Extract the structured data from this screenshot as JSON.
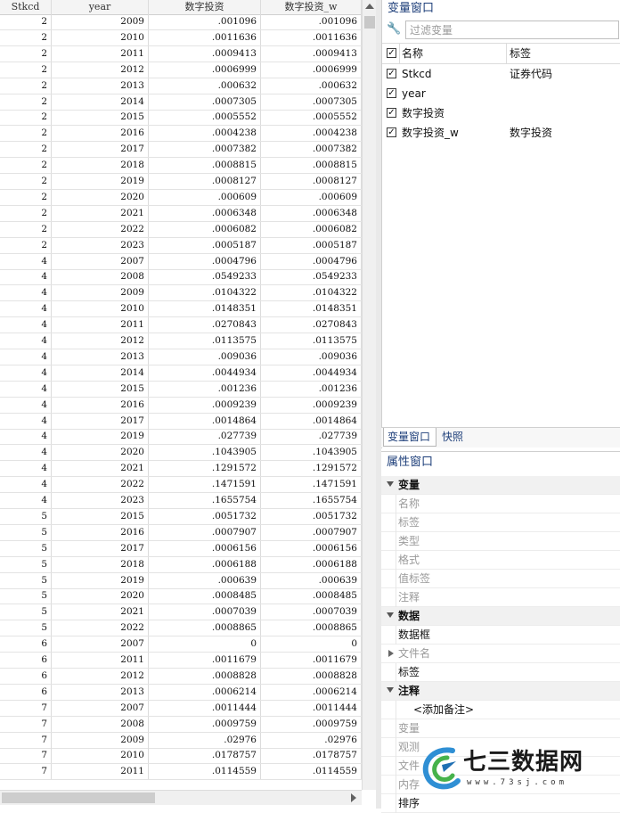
{
  "grid": {
    "columns": [
      "Stkcd",
      "year",
      "数字投资",
      "数字投资_w"
    ],
    "rows": [
      [
        "2",
        "2009",
        ".001096",
        ".001096"
      ],
      [
        "2",
        "2010",
        ".0011636",
        ".0011636"
      ],
      [
        "2",
        "2011",
        ".0009413",
        ".0009413"
      ],
      [
        "2",
        "2012",
        ".0006999",
        ".0006999"
      ],
      [
        "2",
        "2013",
        ".000632",
        ".000632"
      ],
      [
        "2",
        "2014",
        ".0007305",
        ".0007305"
      ],
      [
        "2",
        "2015",
        ".0005552",
        ".0005552"
      ],
      [
        "2",
        "2016",
        ".0004238",
        ".0004238"
      ],
      [
        "2",
        "2017",
        ".0007382",
        ".0007382"
      ],
      [
        "2",
        "2018",
        ".0008815",
        ".0008815"
      ],
      [
        "2",
        "2019",
        ".0008127",
        ".0008127"
      ],
      [
        "2",
        "2020",
        ".000609",
        ".000609"
      ],
      [
        "2",
        "2021",
        ".0006348",
        ".0006348"
      ],
      [
        "2",
        "2022",
        ".0006082",
        ".0006082"
      ],
      [
        "2",
        "2023",
        ".0005187",
        ".0005187"
      ],
      [
        "4",
        "2007",
        ".0004796",
        ".0004796"
      ],
      [
        "4",
        "2008",
        ".0549233",
        ".0549233"
      ],
      [
        "4",
        "2009",
        ".0104322",
        ".0104322"
      ],
      [
        "4",
        "2010",
        ".0148351",
        ".0148351"
      ],
      [
        "4",
        "2011",
        ".0270843",
        ".0270843"
      ],
      [
        "4",
        "2012",
        ".0113575",
        ".0113575"
      ],
      [
        "4",
        "2013",
        ".009036",
        ".009036"
      ],
      [
        "4",
        "2014",
        ".0044934",
        ".0044934"
      ],
      [
        "4",
        "2015",
        ".001236",
        ".001236"
      ],
      [
        "4",
        "2016",
        ".0009239",
        ".0009239"
      ],
      [
        "4",
        "2017",
        ".0014864",
        ".0014864"
      ],
      [
        "4",
        "2019",
        ".027739",
        ".027739"
      ],
      [
        "4",
        "2020",
        ".1043905",
        ".1043905"
      ],
      [
        "4",
        "2021",
        ".1291572",
        ".1291572"
      ],
      [
        "4",
        "2022",
        ".1471591",
        ".1471591"
      ],
      [
        "4",
        "2023",
        ".1655754",
        ".1655754"
      ],
      [
        "5",
        "2015",
        ".0051732",
        ".0051732"
      ],
      [
        "5",
        "2016",
        ".0007907",
        ".0007907"
      ],
      [
        "5",
        "2017",
        ".0006156",
        ".0006156"
      ],
      [
        "5",
        "2018",
        ".0006188",
        ".0006188"
      ],
      [
        "5",
        "2019",
        ".000639",
        ".000639"
      ],
      [
        "5",
        "2020",
        ".0008485",
        ".0008485"
      ],
      [
        "5",
        "2021",
        ".0007039",
        ".0007039"
      ],
      [
        "5",
        "2022",
        ".0008865",
        ".0008865"
      ],
      [
        "6",
        "2007",
        "0",
        "0"
      ],
      [
        "6",
        "2011",
        ".0011679",
        ".0011679"
      ],
      [
        "6",
        "2012",
        ".0008828",
        ".0008828"
      ],
      [
        "6",
        "2013",
        ".0006214",
        ".0006214"
      ],
      [
        "7",
        "2007",
        ".0011444",
        ".0011444"
      ],
      [
        "7",
        "2008",
        ".0009759",
        ".0009759"
      ],
      [
        "7",
        "2009",
        ".02976",
        ".02976"
      ],
      [
        "7",
        "2010",
        ".0178757",
        ".0178757"
      ],
      [
        "7",
        "2011",
        ".0114559",
        ".0114559"
      ]
    ]
  },
  "variables_window": {
    "title": "变量窗口",
    "filter_placeholder": "过滤变量",
    "header": {
      "name": "名称",
      "label": "标签"
    },
    "variables": [
      {
        "name": "Stkcd",
        "label": "证券代码",
        "checked": true
      },
      {
        "name": "year",
        "label": "",
        "checked": true
      },
      {
        "name": "数字投资",
        "label": "",
        "checked": true
      },
      {
        "name": "数字投资_w",
        "label": "数字投资",
        "checked": true
      }
    ],
    "tabs": [
      "变量窗口",
      "快照"
    ]
  },
  "properties_window": {
    "title": "属性窗口",
    "items": [
      {
        "kind": "section",
        "text": "变量"
      },
      {
        "kind": "item",
        "text": "名称"
      },
      {
        "kind": "item",
        "text": "标签"
      },
      {
        "kind": "item",
        "text": "类型"
      },
      {
        "kind": "item",
        "text": "格式"
      },
      {
        "kind": "item",
        "text": "值标签"
      },
      {
        "kind": "item",
        "text": "注释"
      },
      {
        "kind": "section",
        "text": "数据"
      },
      {
        "kind": "item-dark",
        "text": "数据框"
      },
      {
        "kind": "item-collapsed",
        "text": "文件名"
      },
      {
        "kind": "item-dark",
        "text": "标签"
      },
      {
        "kind": "section",
        "text": "注释"
      },
      {
        "kind": "note",
        "text": "<添加备注>"
      },
      {
        "kind": "item",
        "text": "变量"
      },
      {
        "kind": "item",
        "text": "观测"
      },
      {
        "kind": "item",
        "text": "文件"
      },
      {
        "kind": "item",
        "text": "内存"
      },
      {
        "kind": "item-dark",
        "text": "排序"
      }
    ]
  },
  "watermark": {
    "title": "七三数据网",
    "url": "www.73sj.com"
  },
  "icons": {
    "filter": "wrench-icon",
    "checkbox": "check-icon",
    "expand": "triangle-down-icon",
    "collapse": "triangle-right-icon"
  },
  "colors": {
    "pane_title": "#1e3f7a",
    "grid_border": "#dcdcdc",
    "section_bg": "#f1f1f1"
  }
}
